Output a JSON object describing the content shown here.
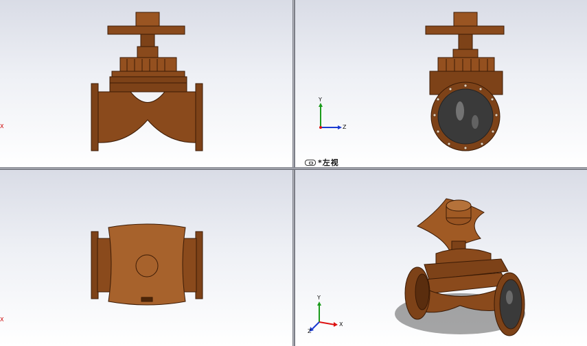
{
  "viewports": {
    "left_view_label": "*左视",
    "front_edge_axis": "X",
    "top_edge_axis": "X"
  },
  "triad_left": {
    "y": "Y",
    "z": "Z"
  },
  "triad_iso": {
    "y": "Y",
    "x": "X",
    "z": "Z"
  },
  "colors": {
    "valve_body": "#8a4a1c",
    "valve_dark": "#4e2608",
    "valve_light": "#b5723a",
    "glass": "#3a3a3a",
    "axis_x": "#d11",
    "axis_y": "#1a9a1a",
    "axis_z": "#1a3ad1"
  },
  "icons": [
    "link-icon",
    "view-triad-icon"
  ]
}
